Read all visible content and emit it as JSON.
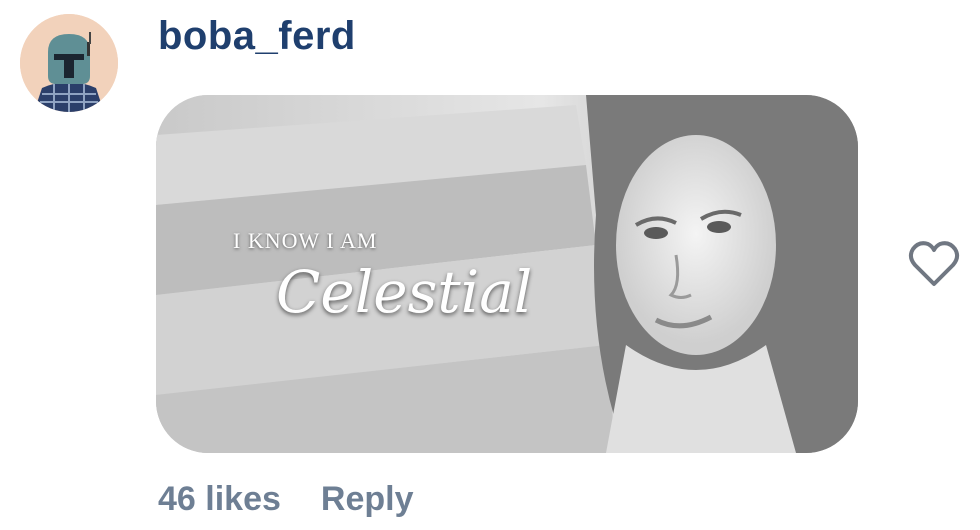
{
  "comment": {
    "username": "boba_ferd",
    "media": {
      "text_line_1": "I KNOW I AM",
      "text_line_2": "Celestial"
    },
    "likes_label": "46 likes",
    "reply_label": "Reply"
  },
  "icons": {
    "like": "heart-outline-icon",
    "avatar": "helmet-avatar-icon"
  },
  "colors": {
    "username": "#1f3f6e",
    "meta_text": "#6e7f94",
    "avatar_bg": "#f2d2bb"
  }
}
